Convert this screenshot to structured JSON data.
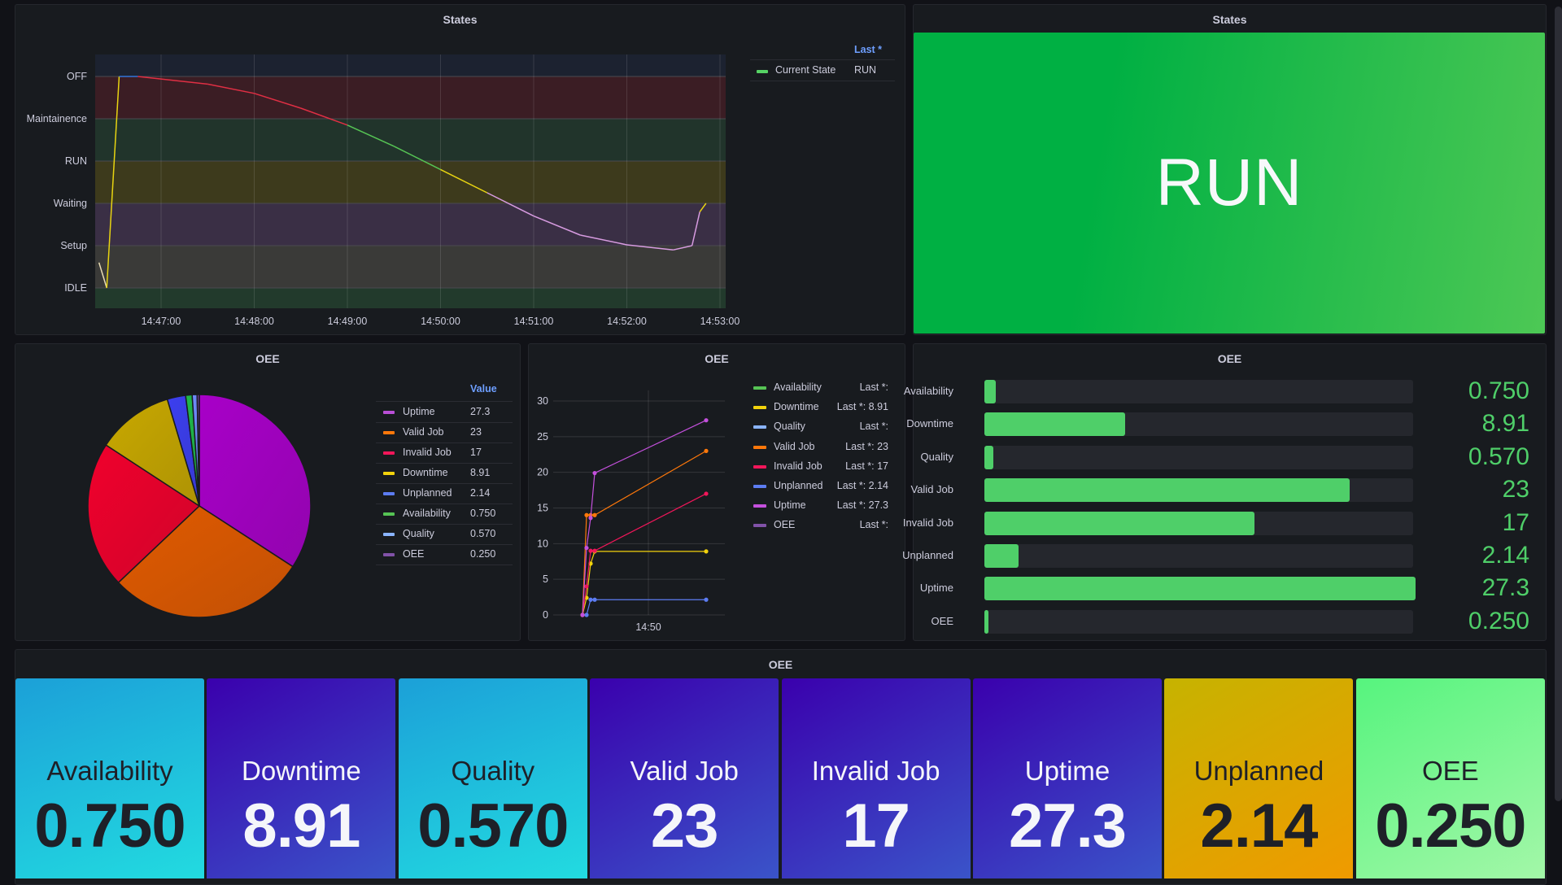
{
  "states_chart_panel": {
    "title": "States",
    "legend_header": "Last *",
    "legend": [
      {
        "name": "Current State",
        "value": "RUN",
        "color": "#56d364"
      }
    ]
  },
  "states_stat_panel": {
    "title": "States",
    "value": "RUN",
    "color": "#1fb94a"
  },
  "pie_panel": {
    "title": "OEE",
    "legend_header": "Value",
    "legend": [
      {
        "name": "Uptime",
        "value": "27.3",
        "color": "#b94fd6"
      },
      {
        "name": "Valid Job",
        "value": "23",
        "color": "#ff780a"
      },
      {
        "name": "Invalid Job",
        "value": "17",
        "color": "#f2165a"
      },
      {
        "name": "Downtime",
        "value": "8.91",
        "color": "#f2d20c"
      },
      {
        "name": "Unplanned",
        "value": "2.14",
        "color": "#5c7cf2"
      },
      {
        "name": "Availability",
        "value": "0.750",
        "color": "#56c454"
      },
      {
        "name": "Quality",
        "value": "0.570",
        "color": "#8ab4ff"
      },
      {
        "name": "OEE",
        "value": "0.250",
        "color": "#8152a8"
      }
    ]
  },
  "timeseries_panel": {
    "title": "OEE",
    "legend": [
      {
        "name": "Availability",
        "value": "Last *:",
        "color": "#56c454"
      },
      {
        "name": "Downtime",
        "value": "Last *: 8.91",
        "color": "#f2d20c"
      },
      {
        "name": "Quality",
        "value": "Last *:",
        "color": "#8ab4ff"
      },
      {
        "name": "Valid Job",
        "value": "Last *: 23",
        "color": "#ff780a"
      },
      {
        "name": "Invalid Job",
        "value": "Last *: 17",
        "color": "#f2165a"
      },
      {
        "name": "Unplanned",
        "value": "Last *: 2.14",
        "color": "#5c7cf2"
      },
      {
        "name": "Uptime",
        "value": "Last *: 27.3",
        "color": "#c450dd"
      },
      {
        "name": "OEE",
        "value": "Last *:",
        "color": "#8152a8"
      }
    ]
  },
  "bargauge_panel": {
    "title": "OEE",
    "fill_color": "#4fcf69",
    "rows": [
      {
        "label": "Availability",
        "value": "0.750",
        "fraction": 0.027
      },
      {
        "label": "Downtime",
        "value": "8.91",
        "fraction": 0.326
      },
      {
        "label": "Quality",
        "value": "0.570",
        "fraction": 0.021
      },
      {
        "label": "Valid Job",
        "value": "23",
        "fraction": 0.848
      },
      {
        "label": "Invalid Job",
        "value": "17",
        "fraction": 0.627
      },
      {
        "label": "Unplanned",
        "value": "2.14",
        "fraction": 0.079
      },
      {
        "label": "Uptime",
        "value": "27.3",
        "fraction": 1.0
      },
      {
        "label": "OEE",
        "value": "0.250",
        "fraction": 0.009
      }
    ]
  },
  "stat_panel": {
    "title": "OEE",
    "tiles": [
      {
        "label": "Availability",
        "value": "0.750",
        "theme": "cyan"
      },
      {
        "label": "Downtime",
        "value": "8.91",
        "theme": "indigo"
      },
      {
        "label": "Quality",
        "value": "0.570",
        "theme": "cyan"
      },
      {
        "label": "Valid Job",
        "value": "23",
        "theme": "indigo"
      },
      {
        "label": "Invalid Job",
        "value": "17",
        "theme": "indigo"
      },
      {
        "label": "Uptime",
        "value": "27.3",
        "theme": "indigo"
      },
      {
        "label": "Unplanned",
        "value": "2.14",
        "theme": "amber"
      },
      {
        "label": "OEE",
        "value": "0.250",
        "theme": "green"
      }
    ]
  },
  "chart_data": [
    {
      "type": "line",
      "title": "States",
      "xlabel": "",
      "ylabel": "",
      "y_categories": [
        "IDLE",
        "Setup",
        "Waiting",
        "RUN",
        "Maintainence",
        "OFF"
      ],
      "x_ticks": [
        "14:47:00",
        "14:48:00",
        "14:49:00",
        "14:50:00",
        "14:51:00",
        "14:52:00",
        "14:53:00"
      ],
      "bands": [
        {
          "from": "IDLE",
          "to": "below",
          "color": "#223a2c"
        },
        {
          "from": "Setup",
          "to": "IDLE",
          "color": "#3a3a38"
        },
        {
          "from": "Waiting",
          "to": "Setup",
          "color": "#3a2f45"
        },
        {
          "from": "RUN",
          "to": "Waiting",
          "color": "#3d3a1c"
        },
        {
          "from": "Maintainence",
          "to": "RUN",
          "color": "#21342b"
        },
        {
          "from": "OFF",
          "to": "Maintainence",
          "color": "#3b1d24"
        },
        {
          "from": "above",
          "to": "OFF",
          "color": "#1c2230"
        }
      ],
      "series": [
        {
          "name": "Current State",
          "points": [
            [
              "14:46:20",
              0.6
            ],
            [
              "14:46:25",
              0.0
            ],
            [
              "14:46:33",
              5.0
            ],
            [
              "14:46:45",
              5.0
            ],
            [
              "14:47:30",
              4.82
            ],
            [
              "14:48:00",
              4.6
            ],
            [
              "14:48:30",
              4.25
            ],
            [
              "14:49:00",
              3.85
            ],
            [
              "14:49:30",
              3.35
            ],
            [
              "14:50:00",
              2.8
            ],
            [
              "14:50:30",
              2.25
            ],
            [
              "14:51:00",
              1.7
            ],
            [
              "14:51:30",
              1.25
            ],
            [
              "14:52:00",
              1.02
            ],
            [
              "14:52:30",
              0.9
            ],
            [
              "14:52:42",
              1.0
            ],
            [
              "14:52:47",
              1.8
            ],
            [
              "14:52:51",
              2.0
            ]
          ]
        }
      ]
    },
    {
      "type": "pie",
      "title": "OEE",
      "categories": [
        "Uptime",
        "Valid Job",
        "Invalid Job",
        "Downtime",
        "Unplanned",
        "Availability",
        "Quality",
        "OEE"
      ],
      "values": [
        27.3,
        23,
        17,
        8.91,
        2.14,
        0.75,
        0.57,
        0.25
      ],
      "colors": [
        "#a800c8",
        "#e05a00",
        "#f0002c",
        "#c8a800",
        "#3c3ff0",
        "#1fb94a",
        "#6f8cff",
        "#7a3fa8"
      ],
      "legend": "right"
    },
    {
      "type": "line",
      "title": "OEE",
      "x_ticks": [
        "14:50"
      ],
      "y_ticks": [
        0,
        5,
        10,
        15,
        20,
        25,
        30
      ],
      "ylim": [
        0,
        30
      ],
      "legend": "right",
      "x_times": [
        "14:49:27",
        "14:49:33",
        "14:49:39",
        "14:49:45",
        "14:51:20"
      ],
      "series": [
        {
          "name": "Uptime",
          "color": "#c450dd",
          "values": [
            0,
            9.4,
            13.6,
            19.9,
            27.3
          ]
        },
        {
          "name": "Valid Job",
          "color": "#ff780a",
          "values": [
            0,
            14,
            14,
            14,
            23
          ]
        },
        {
          "name": "Invalid Job",
          "color": "#f2165a",
          "values": [
            0,
            4,
            9,
            9,
            17
          ]
        },
        {
          "name": "Downtime",
          "color": "#f2d20c",
          "values": [
            0,
            2.4,
            7.2,
            8.91,
            8.91
          ]
        },
        {
          "name": "Unplanned",
          "color": "#5c7cf2",
          "values": [
            0,
            0,
            2.14,
            2.14,
            2.14
          ]
        }
      ]
    }
  ]
}
